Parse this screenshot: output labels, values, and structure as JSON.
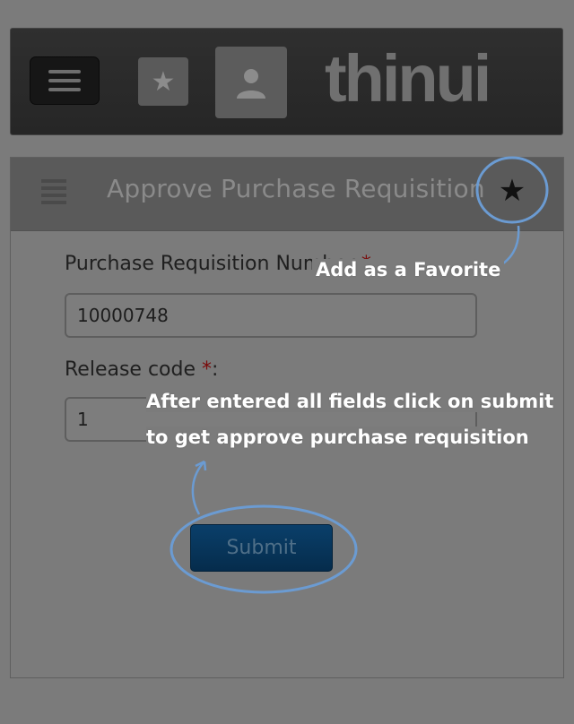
{
  "app": {
    "logo_text": "thinui",
    "menu_icon": "hamburger-icon",
    "favorites_icon": "star-icon",
    "user_icon": "user-icon"
  },
  "page": {
    "title": "Approve Purchase Requisition",
    "menu_icon": "list-icon",
    "favorite_icon": "star-icon"
  },
  "form": {
    "fields": [
      {
        "label": "Purchase Requisition Number",
        "required_mark": "*",
        "suffix": ":",
        "value": "10000748"
      },
      {
        "label": "Release code",
        "required_mark": "*",
        "suffix": ":",
        "value": "1"
      }
    ],
    "submit_label": "Submit"
  },
  "annotations": {
    "favorite": "Add as a Favorite",
    "submit_line1": "After entered all fields click on submit",
    "submit_line2": "to get approve purchase requisition",
    "color": "#6b9bd2"
  },
  "colors": {
    "accent_button": "#0a3f6a",
    "required": "#7a0a0a",
    "overlay": "#7b7b7b"
  }
}
